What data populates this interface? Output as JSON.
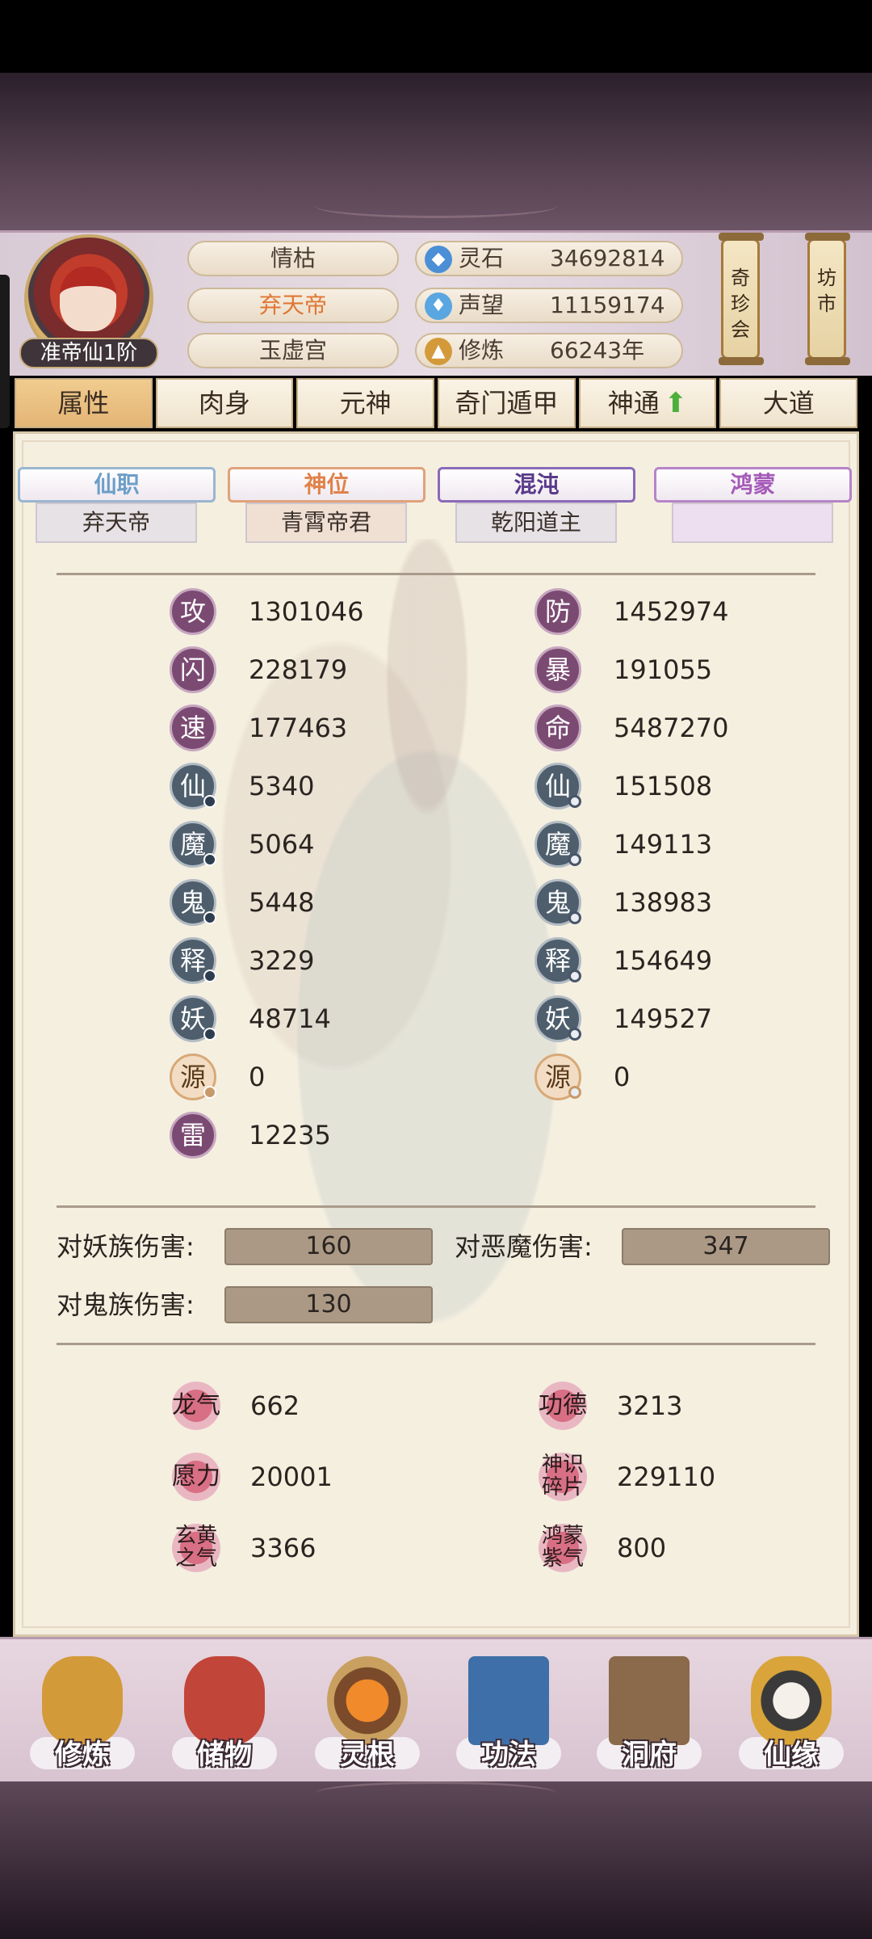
{
  "profile": {
    "rank_badge": "准帝仙1阶",
    "name_rows": [
      "情枯",
      "弃天帝",
      "玉虚宫"
    ]
  },
  "resources": [
    {
      "icon": "spirit-stone-icon",
      "label": "灵石",
      "value": "34692814"
    },
    {
      "icon": "prestige-icon",
      "label": "声望",
      "value": "11159174"
    },
    {
      "icon": "cultivate-icon",
      "label": "修炼",
      "value": "66243年"
    }
  ],
  "side_buttons": {
    "treasure": "奇珍会",
    "market": "坊市"
  },
  "tabs": [
    "属性",
    "肉身",
    "元神",
    "奇门遁甲",
    "神通",
    "大道"
  ],
  "active_tab": "属性",
  "titles": [
    {
      "header": "仙职",
      "value": "弃天帝",
      "color": "#6c9ec8"
    },
    {
      "header": "神位",
      "value": "青霄帝君",
      "color": "#e0824a"
    },
    {
      "header": "混沌",
      "value": "乾阳道主",
      "color": "#5a3a8a"
    },
    {
      "header": "鸿蒙",
      "value": "",
      "color": "#a45ab8"
    }
  ],
  "stats_left": [
    {
      "label": "攻",
      "value": "1301046"
    },
    {
      "label": "闪",
      "value": "228179"
    },
    {
      "label": "速",
      "value": "177463"
    },
    {
      "label": "仙",
      "value": "5340"
    },
    {
      "label": "魔",
      "value": "5064"
    },
    {
      "label": "鬼",
      "value": "5448"
    },
    {
      "label": "释",
      "value": "3229"
    },
    {
      "label": "妖",
      "value": "48714"
    },
    {
      "label": "源",
      "value": "0"
    },
    {
      "label": "雷",
      "value": "12235"
    }
  ],
  "stats_right": [
    {
      "label": "防",
      "value": "1452974"
    },
    {
      "label": "暴",
      "value": "191055"
    },
    {
      "label": "命",
      "value": "5487270"
    },
    {
      "label": "仙",
      "value": "151508"
    },
    {
      "label": "魔",
      "value": "149113"
    },
    {
      "label": "鬼",
      "value": "138983"
    },
    {
      "label": "释",
      "value": "154649"
    },
    {
      "label": "妖",
      "value": "149527"
    },
    {
      "label": "源",
      "value": "0"
    }
  ],
  "damage": [
    {
      "label": "对妖族伤害:",
      "value": "160"
    },
    {
      "label": "对恶魔伤害:",
      "value": "347"
    },
    {
      "label": "对鬼族伤害:",
      "value": "130"
    }
  ],
  "extra_stats": [
    {
      "label": "龙气",
      "value": "662"
    },
    {
      "label": "功德",
      "value": "3213"
    },
    {
      "label": "愿力",
      "value": "20001"
    },
    {
      "label": "神识碎片",
      "value": "229110"
    },
    {
      "label": "玄黄之气",
      "value": "3366"
    },
    {
      "label": "鸿蒙紫气",
      "value": "800"
    }
  ],
  "bottom_nav": [
    "修炼",
    "储物",
    "灵根",
    "功法",
    "洞府",
    "仙缘"
  ]
}
